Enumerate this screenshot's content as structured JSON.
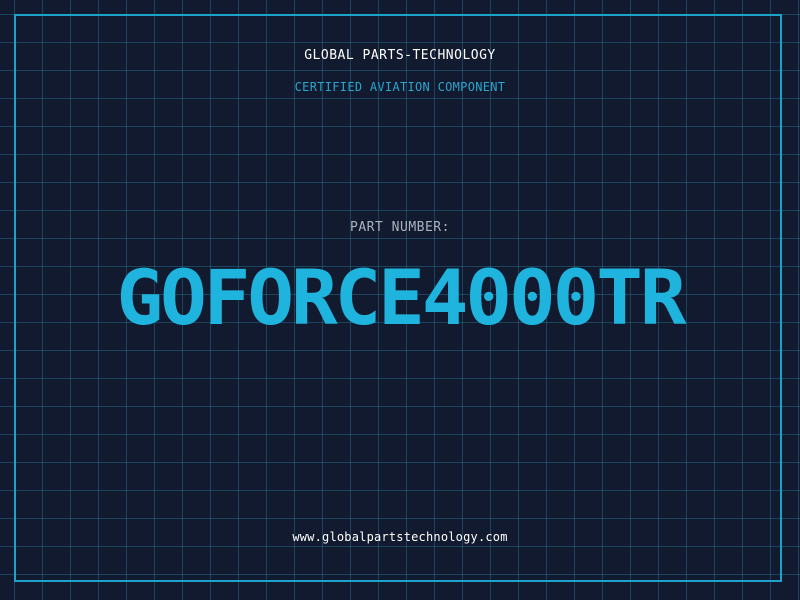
{
  "header": {
    "company": "GLOBAL PARTS-TECHNOLOGY",
    "subtitle": "CERTIFIED AVIATION COMPONENT"
  },
  "part": {
    "label": "PART NUMBER:",
    "number": "GOFORCE4000TR"
  },
  "footer": {
    "website": "www.globalpartstechnology.com"
  },
  "colors": {
    "background": "#111a2e",
    "grid": "#28788f",
    "accent": "#1fb4de",
    "frame": "#1fa2c9"
  }
}
